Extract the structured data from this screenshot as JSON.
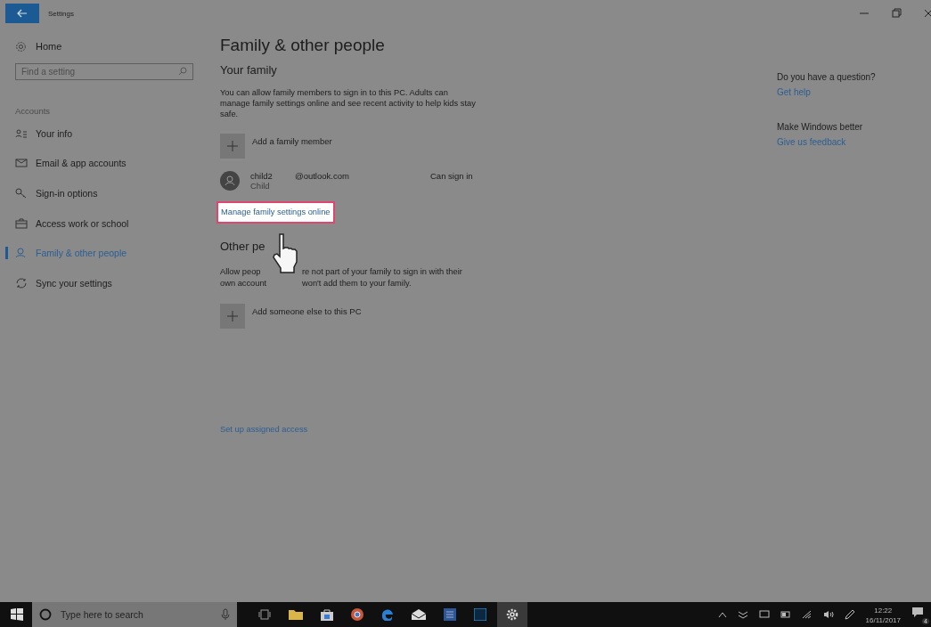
{
  "window": {
    "title": "Settings"
  },
  "sidebar": {
    "home": "Home",
    "search": {
      "placeholder": "Find a setting"
    },
    "section": "Accounts",
    "items": [
      {
        "label": "Your info",
        "selected": false
      },
      {
        "label": "Email & app accounts",
        "selected": false
      },
      {
        "label": "Sign-in options",
        "selected": false
      },
      {
        "label": "Access work or school",
        "selected": false
      },
      {
        "label": "Family & other people",
        "selected": true
      },
      {
        "label": "Sync your settings",
        "selected": false
      }
    ]
  },
  "main": {
    "title": "Family & other people",
    "family": {
      "heading": "Your family",
      "description": "You can allow family members to sign in to this PC. Adults can manage family settings online and see recent activity to help kids stay safe.",
      "add": "Add a family member",
      "members": [
        {
          "name": "child2",
          "role": "Child",
          "email": "@outlook.com",
          "status": "Can sign in"
        }
      ],
      "manage_link": "Manage family settings online",
      "highlighted": true
    },
    "other": {
      "heading": "Other pe",
      "description_lines": [
        [
          "Allow peop",
          "re not part of your family to sign in with their"
        ],
        [
          "own account",
          "won't add them to your family."
        ]
      ],
      "add": "Add someone else to this PC"
    },
    "assigned_access": "Set up assigned access"
  },
  "help": [
    {
      "heading": "Do you have a question?",
      "link": "Get help"
    },
    {
      "heading": "Make Windows better",
      "link": "Give us feedback"
    }
  ],
  "taskbar": {
    "search": {
      "placeholder": "Type here to search"
    },
    "time": "12:22",
    "date": "16/11/2017",
    "notifications": "4"
  }
}
